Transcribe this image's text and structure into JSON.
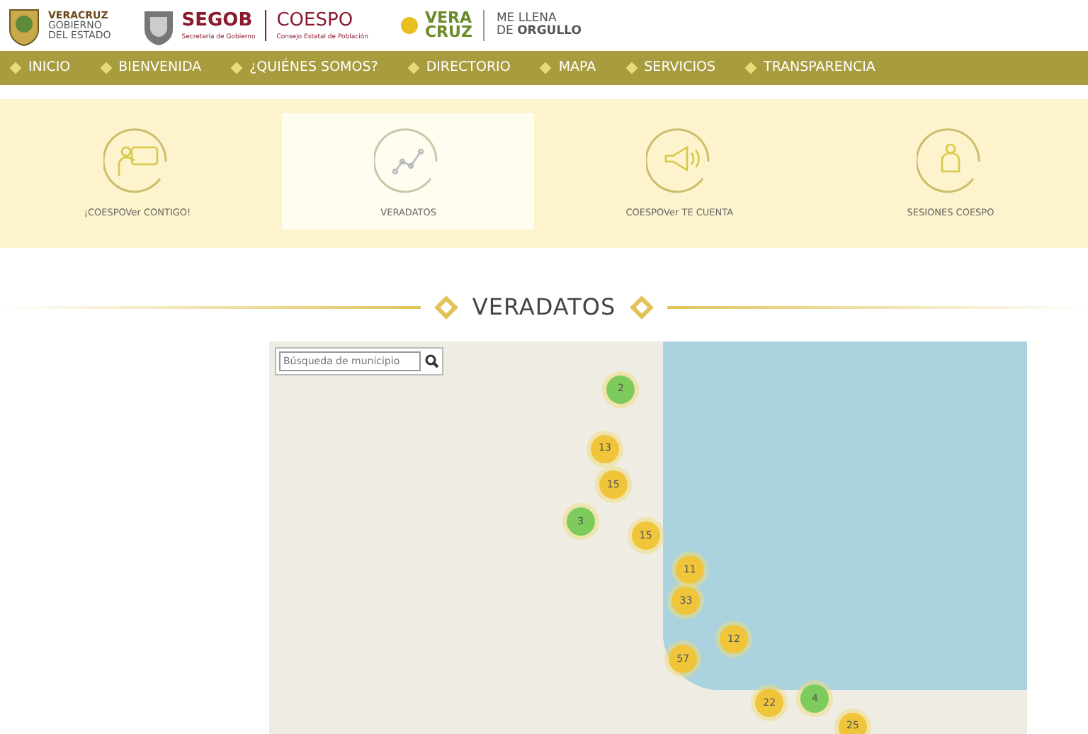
{
  "header": {
    "logos": [
      {
        "kind": "state",
        "lines": [
          "VERACRUZ",
          "GOBIERNO",
          "DEL ESTADO"
        ]
      },
      {
        "kind": "segob",
        "title": "SEGOB",
        "subtitle": "Secretaría de Gobierno",
        "org": "COESPO",
        "org_subtitle": "Consejo Estatal de Población"
      },
      {
        "kind": "brand",
        "mark_lines": [
          "VERA",
          "CRUZ"
        ],
        "slogan_lines": [
          "ME LLENA",
          "DE **ORGULLO**"
        ]
      }
    ]
  },
  "nav": {
    "items": [
      {
        "label": "INICIO"
      },
      {
        "label": "BIENVENIDA"
      },
      {
        "label": "¿QUIÉNES SOMOS?"
      },
      {
        "label": "DIRECTORIO"
      },
      {
        "label": "MAPA"
      },
      {
        "label": "SERVICIOS"
      },
      {
        "label": "TRANSPARENCIA"
      }
    ]
  },
  "sections": [
    {
      "kind": "presenter",
      "label": "¡COESPOVer CONTIGO!",
      "selected": false
    },
    {
      "kind": "chart",
      "label": "VERADATOS",
      "selected": true
    },
    {
      "kind": "megaphone",
      "label": "COESPOVer TE CUENTA",
      "selected": false
    },
    {
      "kind": "person",
      "label": "SESIONES COESPO",
      "selected": false
    }
  ],
  "heading": "VERADATOS",
  "map": {
    "search": {
      "placeholder": "Búsqueda de municipio"
    },
    "clusters": [
      {
        "count": "2",
        "color": "#7dcb5c"
      },
      {
        "count": "13",
        "color": "#f0c53a"
      },
      {
        "count": "15",
        "color": "#f0c53a"
      },
      {
        "count": "3",
        "color": "#7dcb5c"
      },
      {
        "count": "15",
        "color": "#f0c53a"
      },
      {
        "count": "11",
        "color": "#f0c53a"
      },
      {
        "count": "33",
        "color": "#f0c53a"
      },
      {
        "count": "12",
        "color": "#f0c53a"
      },
      {
        "count": "57",
        "color": "#f0c53a"
      },
      {
        "count": "22",
        "color": "#f0c53a"
      },
      {
        "count": "4",
        "color": "#7dcb5c"
      },
      {
        "count": "25",
        "color": "#f0c53a"
      }
    ]
  }
}
